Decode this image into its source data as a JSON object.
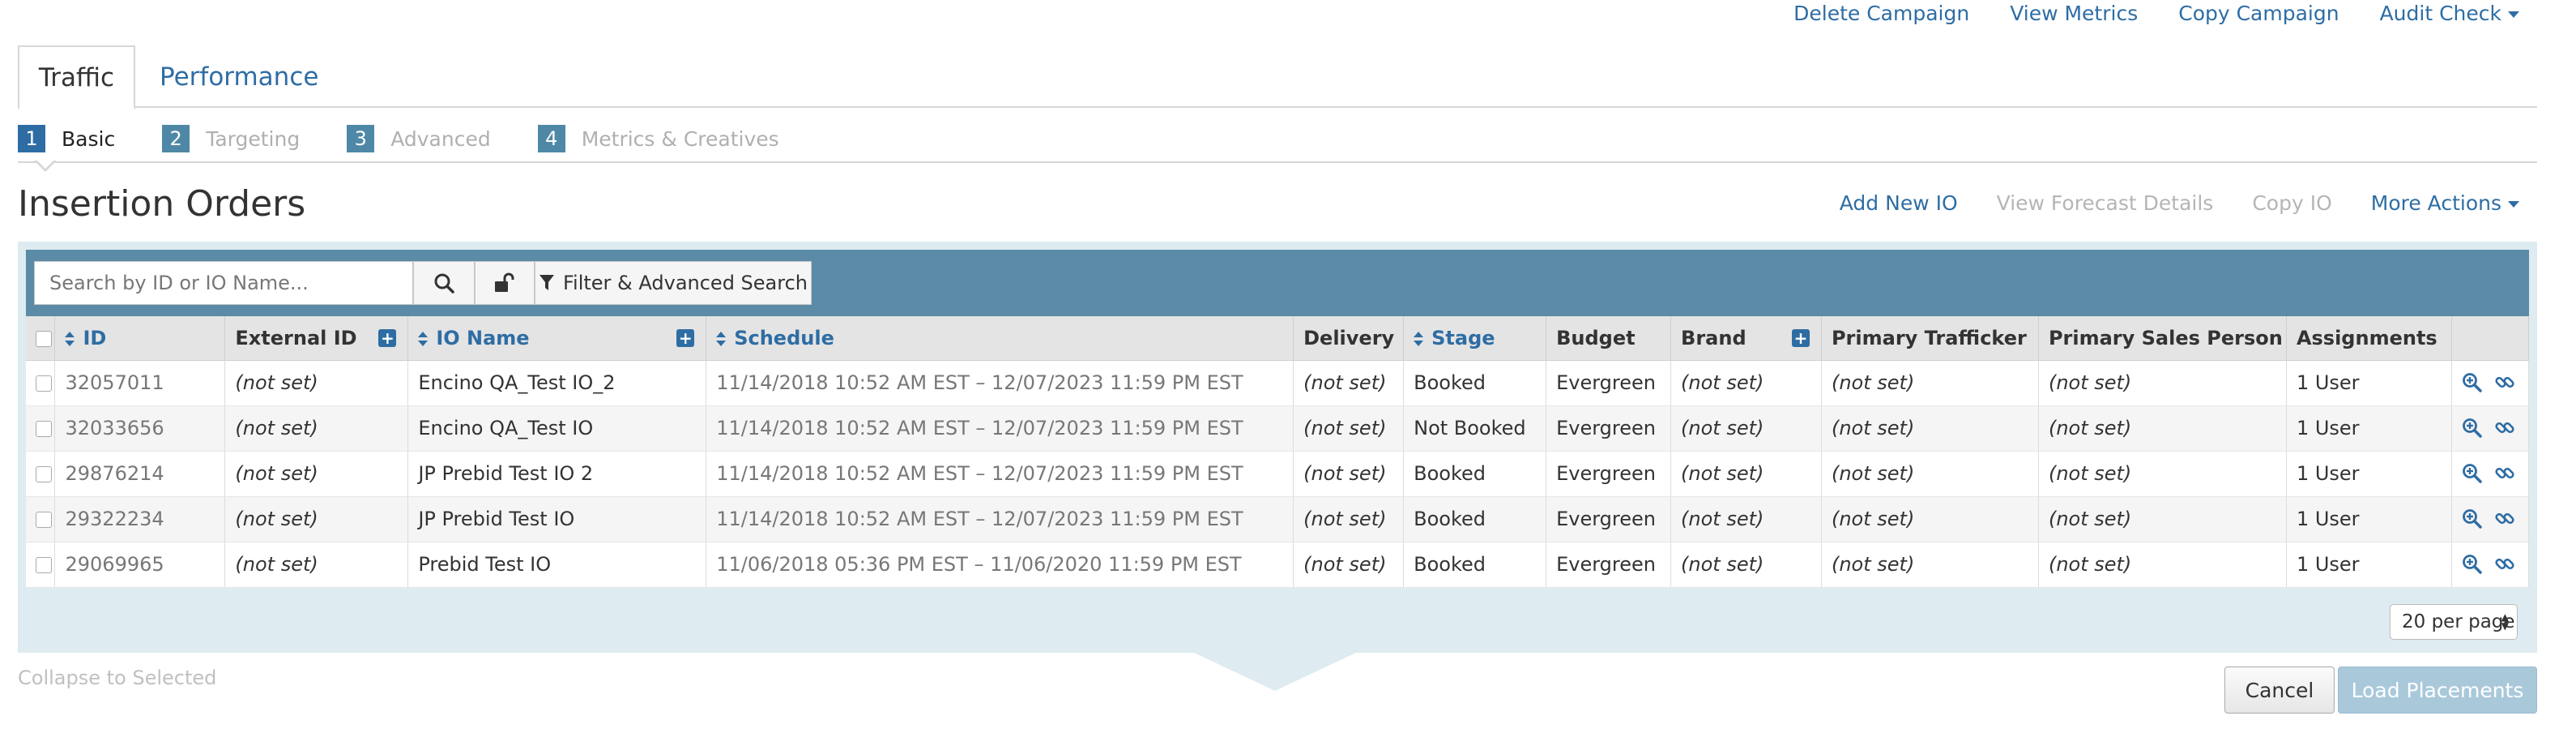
{
  "top_actions": [
    "Delete Campaign",
    "View Metrics",
    "Copy Campaign",
    "Audit Check"
  ],
  "tabs": [
    {
      "label": "Traffic",
      "active": true
    },
    {
      "label": "Performance",
      "active": false
    }
  ],
  "steps": [
    {
      "num": "1",
      "label": "Basic",
      "active": true
    },
    {
      "num": "2",
      "label": "Targeting",
      "active": false
    },
    {
      "num": "3",
      "label": "Advanced",
      "active": false
    },
    {
      "num": "4",
      "label": "Metrics & Creatives",
      "active": false
    }
  ],
  "section": {
    "title": "Insertion Orders",
    "actions": {
      "add": "Add New IO",
      "forecast": "View Forecast Details",
      "copy": "Copy IO",
      "more": "More Actions"
    }
  },
  "toolbar": {
    "search_placeholder": "Search by ID or IO Name...",
    "filter_label": "Filter & Advanced Search"
  },
  "table": {
    "columns": {
      "id": "ID",
      "external_id": "External ID",
      "io_name": "IO Name",
      "schedule": "Schedule",
      "delivery": "Delivery",
      "stage": "Stage",
      "budget": "Budget",
      "brand": "Brand",
      "primary_trafficker": "Primary Trafficker",
      "primary_sales_person": "Primary Sales Person",
      "assignments": "Assignments"
    },
    "rows": [
      {
        "id": "32057011",
        "external_id": "(not set)",
        "io_name": "Encino QA_Test IO_2",
        "schedule": "11/14/2018 10:52 AM EST – 12/07/2023 11:59 PM EST",
        "delivery": "(not set)",
        "stage": "Booked",
        "budget": "Evergreen",
        "brand": "(not set)",
        "primary_trafficker": "(not set)",
        "primary_sales_person": "(not set)",
        "assignments": "1 User"
      },
      {
        "id": "32033656",
        "external_id": "(not set)",
        "io_name": "Encino QA_Test IO",
        "schedule": "11/14/2018 10:52 AM EST – 12/07/2023 11:59 PM EST",
        "delivery": "(not set)",
        "stage": "Not Booked",
        "budget": "Evergreen",
        "brand": "(not set)",
        "primary_trafficker": "(not set)",
        "primary_sales_person": "(not set)",
        "assignments": "1 User"
      },
      {
        "id": "29876214",
        "external_id": "(not set)",
        "io_name": "JP Prebid Test IO 2",
        "schedule": "11/14/2018 10:52 AM EST – 12/07/2023 11:59 PM EST",
        "delivery": "(not set)",
        "stage": "Booked",
        "budget": "Evergreen",
        "brand": "(not set)",
        "primary_trafficker": "(not set)",
        "primary_sales_person": "(not set)",
        "assignments": "1 User"
      },
      {
        "id": "29322234",
        "external_id": "(not set)",
        "io_name": "JP Prebid Test IO",
        "schedule": "11/14/2018 10:52 AM EST – 12/07/2023 11:59 PM EST",
        "delivery": "(not set)",
        "stage": "Booked",
        "budget": "Evergreen",
        "brand": "(not set)",
        "primary_trafficker": "(not set)",
        "primary_sales_person": "(not set)",
        "assignments": "1 User"
      },
      {
        "id": "29069965",
        "external_id": "(not set)",
        "io_name": "Prebid Test IO",
        "schedule": "11/06/2018 05:36 PM EST – 11/06/2020 11:59 PM EST",
        "delivery": "(not set)",
        "stage": "Booked",
        "budget": "Evergreen",
        "brand": "(not set)",
        "primary_trafficker": "(not set)",
        "primary_sales_person": "(not set)",
        "assignments": "1 User"
      }
    ]
  },
  "pagination": {
    "per_page": "20 per page"
  },
  "footer": {
    "collapse": "Collapse to Selected",
    "cancel": "Cancel",
    "load": "Load Placements"
  },
  "colors": {
    "link": "#2e6da4",
    "toolbar": "#5b8ba6",
    "panel": "#deebf0",
    "disabled": "#b5b5b5"
  }
}
